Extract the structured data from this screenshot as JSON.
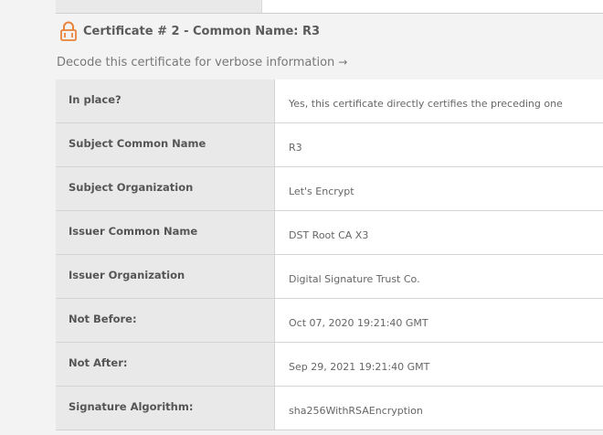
{
  "certificate": {
    "heading": "Certificate # 2 - Common Name: R3",
    "decode_link": "Decode this certificate for verbose information",
    "decode_arrow": "→",
    "lock_icon": "open-padlock-icon",
    "accent_color": "#e8833a",
    "rows": [
      {
        "label": "In place?",
        "value": "Yes, this certificate directly certifies the preceding one"
      },
      {
        "label": "Subject Common Name",
        "value": "R3"
      },
      {
        "label": "Subject Organization",
        "value": "Let's Encrypt"
      },
      {
        "label": "Issuer Common Name",
        "value": "DST Root CA X3"
      },
      {
        "label": "Issuer Organization",
        "value": "Digital Signature Trust Co."
      },
      {
        "label": "Not Before:",
        "value": "Oct 07, 2020 19:21:40 GMT"
      },
      {
        "label": "Not After:",
        "value": "Sep 29, 2021 19:21:40 GMT"
      },
      {
        "label": "Signature Algorithm:",
        "value": "sha256WithRSAEncryption"
      }
    ]
  }
}
